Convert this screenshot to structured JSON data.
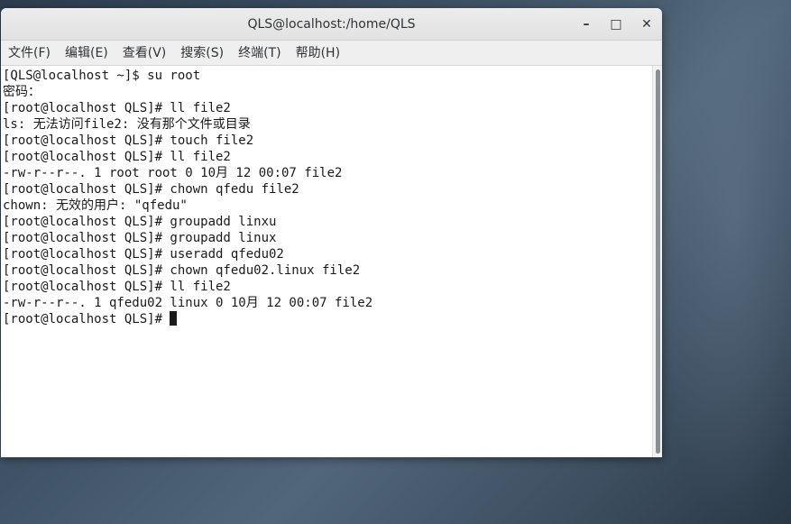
{
  "window": {
    "title": "QLS@localhost:/home/QLS",
    "controls": {
      "minimize": "–",
      "maximize": "□",
      "close": "✕"
    }
  },
  "menu": [
    {
      "label": "文件(F)"
    },
    {
      "label": "编辑(E)"
    },
    {
      "label": "查看(V)"
    },
    {
      "label": "搜索(S)"
    },
    {
      "label": "终端(T)"
    },
    {
      "label": "帮助(H)"
    }
  ],
  "terminal": {
    "lines": [
      "[QLS@localhost ~]$ su root",
      "密码：",
      "[root@localhost QLS]# ll file2",
      "ls: 无法访问file2: 没有那个文件或目录",
      "[root@localhost QLS]# touch file2",
      "[root@localhost QLS]# ll file2",
      "-rw-r--r--. 1 root root 0 10月 12 00:07 file2",
      "[root@localhost QLS]# chown qfedu file2",
      "chown: 无效的用户: \"qfedu\"",
      "[root@localhost QLS]# groupadd linxu",
      "[root@localhost QLS]# groupadd linux",
      "[root@localhost QLS]# useradd qfedu02",
      "[root@localhost QLS]# chown qfedu02.linux file2",
      "[root@localhost QLS]# ll file2",
      "-rw-r--r--. 1 qfedu02 linux 0 10月 12 00:07 file2"
    ],
    "prompt": "[root@localhost QLS]# "
  }
}
